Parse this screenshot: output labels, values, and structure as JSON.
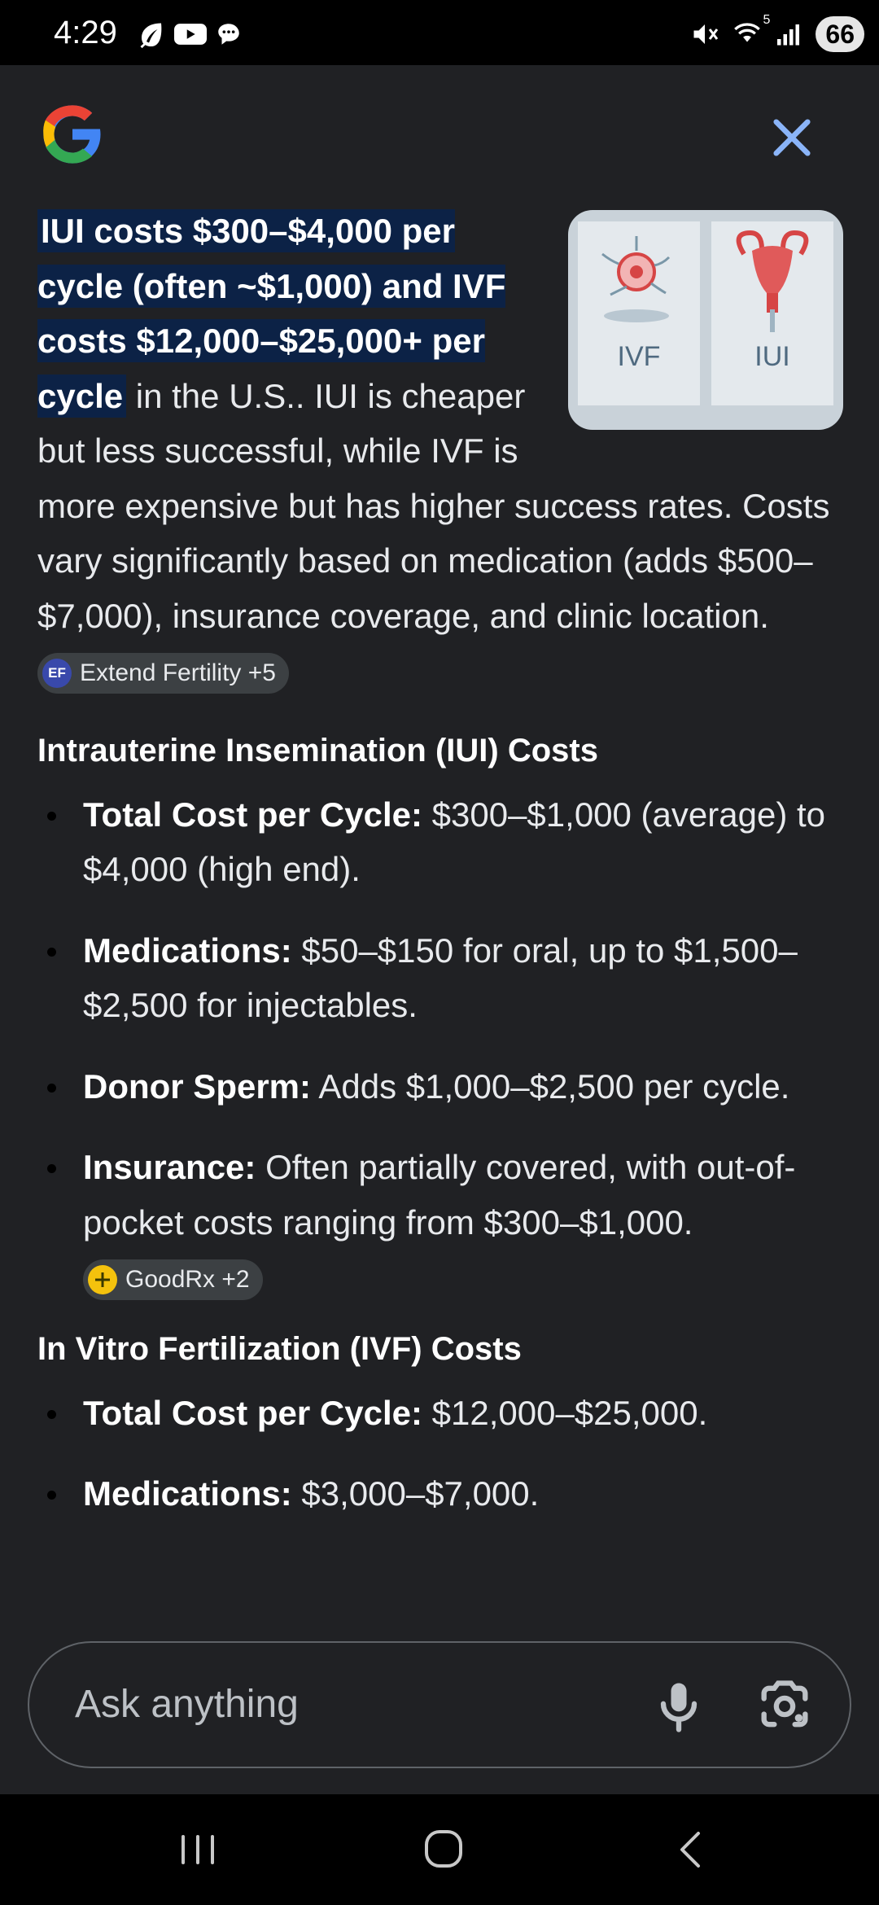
{
  "status_bar": {
    "time": "4:29",
    "left_icons": [
      "leaf-icon",
      "youtube-icon",
      "chat-bubble-icon"
    ],
    "right_icons": [
      "mute-icon",
      "wifi-icon",
      "signal-icon"
    ],
    "wifi_badge": "5",
    "battery": "66"
  },
  "header": {
    "logo": "google-g-logo",
    "close_icon": "close-icon"
  },
  "hero_image": {
    "left_label": "IVF",
    "right_label": "IUI"
  },
  "answer": {
    "highlight": "IUI costs $300–$4,000 per cycle (often ~$1,000) and IVF costs $12,000–$25,000+ per cycle",
    "rest": " in the U.S.. IUI is cheaper but less successful, while IVF is more expensive but has higher success rates. Costs vary significantly based on medication (adds $500–$7,000), insurance coverage, and clinic location.",
    "source_chip": {
      "icon_text": "EF",
      "label": "Extend Fertility +5"
    }
  },
  "sections": [
    {
      "heading": "Intrauterine Insemination (IUI) Costs",
      "items": [
        {
          "term": "Total Cost per Cycle:",
          "text": " $300–$1,000 (average) to $4,000 (high end)."
        },
        {
          "term": "Medications:",
          "text": " $50–$150 for oral, up to $1,500–$2,500 for injectables."
        },
        {
          "term": "Donor Sperm:",
          "text": " Adds $1,000–$2,500 per cycle."
        },
        {
          "term": "Insurance:",
          "text": " Often partially covered, with out-of-pocket costs ranging from $300–$1,000."
        }
      ],
      "source_chip": {
        "label": "GoodRx +2"
      }
    },
    {
      "heading": "In Vitro Fertilization (IVF) Costs",
      "items": [
        {
          "term": "Total Cost per Cycle:",
          "text": " $12,000–$25,000."
        },
        {
          "term": "Medications:",
          "text": " $3,000–$7,000."
        }
      ]
    }
  ],
  "input": {
    "placeholder": "Ask anything",
    "mic_icon": "microphone-icon",
    "lens_icon": "camera-lens-icon"
  },
  "nav": [
    "recents-icon",
    "home-icon",
    "back-icon"
  ],
  "colors": {
    "background": "#202124",
    "highlight_bg": "#0c2246",
    "chip_bg": "#3c4043",
    "accent_blue": "#8ab4f8"
  }
}
